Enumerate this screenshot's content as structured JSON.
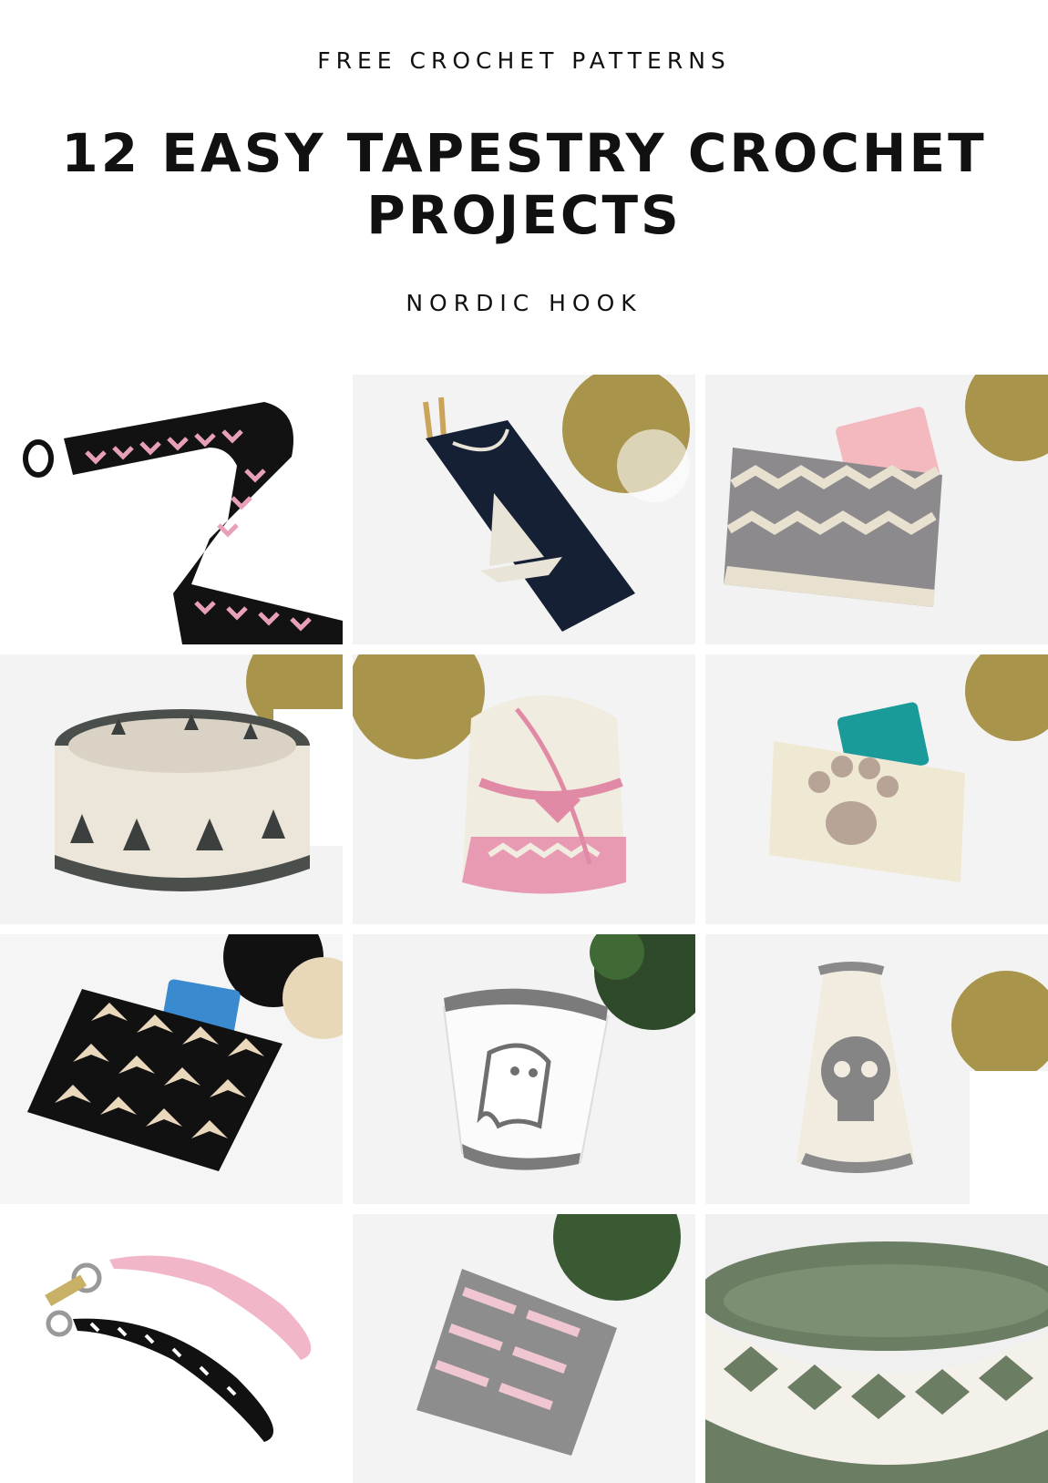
{
  "header": {
    "eyebrow": "FREE CROCHET PATTERNS",
    "title": "12 EASY TAPESTRY CROCHET PROJECTS",
    "author": "NORDIC HOOK"
  },
  "projects": [
    {
      "subject": "pink-chevron-bag-strap"
    },
    {
      "subject": "navy-sailboat-hook-case"
    },
    {
      "subject": "grey-zigzag-zipper-pouch"
    },
    {
      "subject": "pine-tree-basket"
    },
    {
      "subject": "pink-heart-drawstring-bag"
    },
    {
      "subject": "paw-print-pouch"
    },
    {
      "subject": "black-arrow-card-pouch"
    },
    {
      "subject": "ghost-drawstring-bag"
    },
    {
      "subject": "skull-drawstring-bag"
    },
    {
      "subject": "key-fob-wristlets"
    },
    {
      "subject": "striped-brick-pouch"
    },
    {
      "subject": "green-diamond-basket"
    }
  ]
}
